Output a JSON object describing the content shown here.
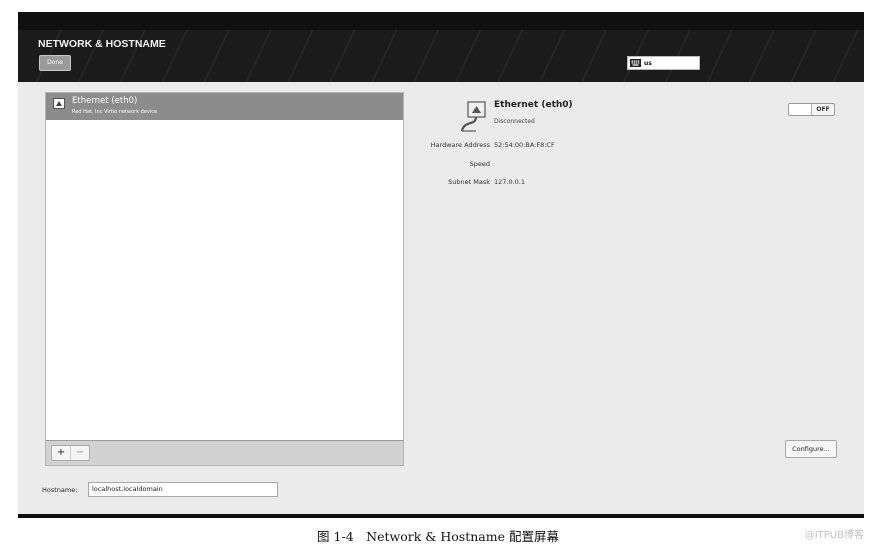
{
  "header": {
    "title": "NETWORK & HOSTNAME",
    "done_label": "Done",
    "keyboard_layout": "us"
  },
  "devices": [
    {
      "name": "Ethernet (eth0)",
      "description": "Red Hat, Inc Virtio network device"
    }
  ],
  "list_toolbar": {
    "add_label": "+",
    "remove_label": "−"
  },
  "detail": {
    "name": "Ethernet (eth0)",
    "status": "Disconnected",
    "toggle_label": "OFF",
    "properties": [
      {
        "label": "Hardware Address",
        "value": "52:54:00:BA:F8:CF"
      },
      {
        "label": "Speed",
        "value": ""
      },
      {
        "label": "Subnet Mask",
        "value": "127.0.0.1"
      }
    ],
    "configure_label": "Configure..."
  },
  "hostname": {
    "label": "Hostname:",
    "value": "localhost.localdomain"
  },
  "caption": "图 1-4　Network & Hostname 配置屏幕",
  "watermark": "@ITPUB博客"
}
